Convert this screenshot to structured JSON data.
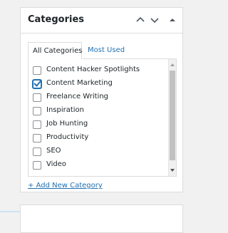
{
  "panel": {
    "title": "Categories",
    "controls": [
      "chevron-up-icon",
      "chevron-down-icon",
      "caret-up-icon"
    ]
  },
  "tabs": {
    "all": "All Categories",
    "most_used": "Most Used"
  },
  "categories": [
    {
      "label": "Content Hacker Spotlights",
      "checked": false
    },
    {
      "label": "Content Marketing",
      "checked": true
    },
    {
      "label": "Freelance Writing",
      "checked": false
    },
    {
      "label": "Inspiration",
      "checked": false
    },
    {
      "label": "Job Hunting",
      "checked": false
    },
    {
      "label": "Productivity",
      "checked": false
    },
    {
      "label": "SEO",
      "checked": false
    },
    {
      "label": "Video",
      "checked": false
    }
  ],
  "add_link": "+ Add New Category",
  "colors": {
    "accent": "#2271b1",
    "border": "#dcdcde",
    "background": "#f1f1f1"
  }
}
